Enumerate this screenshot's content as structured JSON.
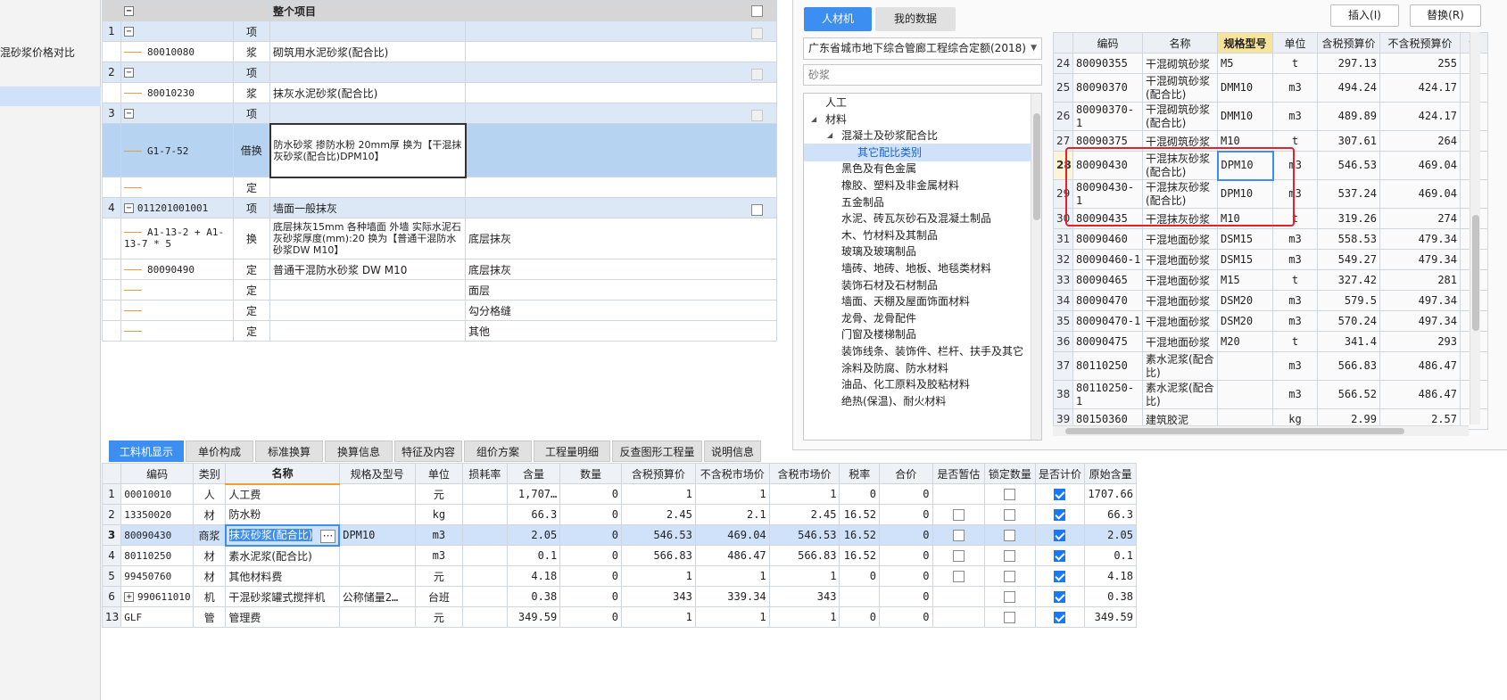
{
  "left_panel": {
    "items": [
      "混砂浆价格对比"
    ]
  },
  "top_grid": {
    "header": {
      "title": "整个项目"
    },
    "rows": [
      {
        "no": "1",
        "expander": "−",
        "code": "",
        "type": "项",
        "name": "",
        "spec": "",
        "row": "blue"
      },
      {
        "no": "",
        "expander": "",
        "code": "80010080",
        "type": "浆",
        "name": "砌筑用水泥砂浆(配合比)",
        "spec": "",
        "row": "white"
      },
      {
        "no": "2",
        "expander": "−",
        "code": "",
        "type": "项",
        "name": "",
        "spec": "",
        "row": "blue"
      },
      {
        "no": "",
        "expander": "",
        "code": "80010230",
        "type": "浆",
        "name": "抹灰水泥砂浆(配合比)",
        "spec": "",
        "row": "white"
      },
      {
        "no": "3",
        "expander": "−",
        "code": "",
        "type": "项",
        "name": "",
        "spec": "",
        "row": "blue"
      },
      {
        "no": "",
        "expander": "",
        "code": "G1-7-52",
        "type": "借换",
        "name": "防水砂浆 掺防水粉 20mm厚  换为【干混抹灰砂浆(配合比)DPM10】",
        "spec": "",
        "row": "sel"
      },
      {
        "no": "",
        "expander": "",
        "code": "",
        "type": "定",
        "name": "",
        "spec": "",
        "row": "white"
      },
      {
        "no": "4",
        "expander": "−",
        "code": "011201001001",
        "type": "项",
        "name": "墙面一般抹灰",
        "spec": "",
        "row": "blue"
      },
      {
        "no": "",
        "expander": "",
        "code": "A1-13-2 + A1-13-7 * 5",
        "type": "换",
        "name": "底层抹灰15mm 各种墙面 外墙  实际水泥石灰砂浆厚度(mm):20  换为【普通干混防水砂浆DW M10】",
        "spec": "底层抹灰",
        "row": "white"
      },
      {
        "no": "",
        "expander": "",
        "code": "80090490",
        "type": "定",
        "name": "普通干混防水砂浆 DW M10",
        "spec": "底层抹灰",
        "row": "white"
      },
      {
        "no": "",
        "expander": "",
        "code": "",
        "type": "定",
        "name": "",
        "spec": "面层",
        "row": "white"
      },
      {
        "no": "",
        "expander": "",
        "code": "",
        "type": "定",
        "name": "",
        "spec": "勾分格缝",
        "row": "white"
      },
      {
        "no": "",
        "expander": "",
        "code": "",
        "type": "定",
        "name": "",
        "spec": "其他",
        "row": "white"
      }
    ]
  },
  "tabs": [
    "工料机显示",
    "单价构成",
    "标准换算",
    "换算信息",
    "特征及内容",
    "组价方案",
    "工程量明细",
    "反查图形工程量",
    "说明信息"
  ],
  "bottom_grid": {
    "columns": [
      "编码",
      "类别",
      "名称",
      "规格及型号",
      "单位",
      "损耗率",
      "含量",
      "数量",
      "含税预算价",
      "不含税市场价",
      "含税市场价",
      "税率",
      "合价",
      "是否暂估",
      "锁定数量",
      "是否计价",
      "原始含量"
    ],
    "rows": [
      {
        "no": "1",
        "code": "00010010",
        "cat": "人",
        "name": "人工费",
        "spec": "",
        "unit": "元",
        "loss": "",
        "qty": "1,707…",
        "amt": "0",
        "p1": "1",
        "p2": "1",
        "p3": "1",
        "tax": "0",
        "total": "0",
        "est": "none",
        "lock": "off",
        "price": "on",
        "orig": "1707.66"
      },
      {
        "no": "2",
        "code": "13350020",
        "cat": "材",
        "name": "防水粉",
        "spec": "",
        "unit": "kg",
        "loss": "",
        "qty": "66.3",
        "amt": "0",
        "p1": "2.45",
        "p2": "2.1",
        "p3": "2.45",
        "tax": "16.52",
        "total": "0",
        "est": "off",
        "lock": "off",
        "price": "on",
        "orig": "66.3"
      },
      {
        "no": "3",
        "code": "80090430",
        "cat": "商浆",
        "name": "抹灰砂浆(配合比)",
        "spec": "DPM10",
        "unit": "m3",
        "loss": "",
        "qty": "2.05",
        "amt": "0",
        "p1": "546.53",
        "p2": "469.04",
        "p3": "546.53",
        "tax": "16.52",
        "total": "0",
        "est": "off",
        "lock": "off",
        "price": "on",
        "orig": "2.05"
      },
      {
        "no": "4",
        "code": "80110250",
        "cat": "材",
        "name": "素水泥浆(配合比)",
        "spec": "",
        "unit": "m3",
        "loss": "",
        "qty": "0.1",
        "amt": "0",
        "p1": "566.83",
        "p2": "486.47",
        "p3": "566.83",
        "tax": "16.52",
        "total": "0",
        "est": "off",
        "lock": "off",
        "price": "on",
        "orig": "0.1"
      },
      {
        "no": "5",
        "code": "99450760",
        "cat": "材",
        "name": "其他材料费",
        "spec": "",
        "unit": "元",
        "loss": "",
        "qty": "4.18",
        "amt": "0",
        "p1": "1",
        "p2": "1",
        "p3": "1",
        "tax": "0",
        "total": "0",
        "est": "off",
        "lock": "off",
        "price": "on",
        "orig": "4.18"
      },
      {
        "no": "6",
        "code": "990611010",
        "cat": "机",
        "name": "干混砂浆罐式搅拌机",
        "spec": "公称储量2…",
        "unit": "台班",
        "loss": "",
        "qty": "0.38",
        "amt": "0",
        "p1": "343",
        "p2": "339.34",
        "p3": "343",
        "tax": "",
        "total": "0",
        "est": "none",
        "lock": "off",
        "price": "on",
        "orig": "0.38"
      },
      {
        "no": "13",
        "code": "GLF",
        "cat": "管",
        "name": "管理费",
        "spec": "",
        "unit": "元",
        "loss": "",
        "qty": "349.59",
        "amt": "0",
        "p1": "1",
        "p2": "1",
        "p3": "1",
        "tax": "0",
        "total": "0",
        "est": "none",
        "lock": "off",
        "price": "on",
        "orig": "349.59"
      }
    ]
  },
  "dialog": {
    "tab_active": "人材机",
    "tab_other": "我的数据",
    "insert": "插入(I)",
    "replace": "替换(R)",
    "quota": "广东省城市地下综合管廊工程综合定额(2018)",
    "search_placeholder": "砂浆",
    "tree": [
      {
        "label": "人工",
        "lvl": 0,
        "arrow": ""
      },
      {
        "label": "材料",
        "lvl": 0,
        "arrow": "◢"
      },
      {
        "label": "混凝土及砂浆配合比",
        "lvl": 1,
        "arrow": "◢"
      },
      {
        "label": "其它配比类别",
        "lvl": 2,
        "arrow": "",
        "sel": true
      },
      {
        "label": "黑色及有色金属",
        "lvl": 1,
        "arrow": ""
      },
      {
        "label": "橡胶、塑料及非金属材料",
        "lvl": 1,
        "arrow": ""
      },
      {
        "label": "五金制品",
        "lvl": 1,
        "arrow": ""
      },
      {
        "label": "水泥、砖瓦灰砂石及混凝土制品",
        "lvl": 1,
        "arrow": ""
      },
      {
        "label": "木、竹材料及其制品",
        "lvl": 1,
        "arrow": ""
      },
      {
        "label": "玻璃及玻璃制品",
        "lvl": 1,
        "arrow": ""
      },
      {
        "label": "墙砖、地砖、地板、地毯类材料",
        "lvl": 1,
        "arrow": ""
      },
      {
        "label": "装饰石材及石材制品",
        "lvl": 1,
        "arrow": ""
      },
      {
        "label": "墙面、天棚及屋面饰面材料",
        "lvl": 1,
        "arrow": ""
      },
      {
        "label": "龙骨、龙骨配件",
        "lvl": 1,
        "arrow": ""
      },
      {
        "label": "门窗及楼梯制品",
        "lvl": 1,
        "arrow": ""
      },
      {
        "label": "装饰线条、装饰件、栏杆、扶手及其它",
        "lvl": 1,
        "arrow": ""
      },
      {
        "label": "涂料及防腐、防水材料",
        "lvl": 1,
        "arrow": ""
      },
      {
        "label": "油品、化工原料及胶粘材料",
        "lvl": 1,
        "arrow": ""
      },
      {
        "label": "绝热(保温)、耐火材料",
        "lvl": 1,
        "arrow": ""
      }
    ],
    "grid_columns": [
      "编码",
      "名称",
      "规格型号",
      "单位",
      "含税预算价",
      "不含税预算价",
      "含"
    ],
    "grid_rows": [
      {
        "no": "24",
        "code": "80090355",
        "name": "干混砌筑砂浆",
        "spec": "M5",
        "unit": "t",
        "p1": "297.13",
        "p2": "255",
        "x": "1",
        "tall": false
      },
      {
        "no": "25",
        "code": "80090370",
        "name": "干混砌筑砂浆(配合比)",
        "spec": "DMM10",
        "unit": "m3",
        "p1": "494.24",
        "p2": "424.17",
        "x": "1",
        "tall": true
      },
      {
        "no": "26",
        "code": "80090370-1",
        "name": "干混砌筑砂浆(配合比)",
        "spec": "DMM10",
        "unit": "m3",
        "p1": "489.89",
        "p2": "424.17",
        "x": "1",
        "tall": true
      },
      {
        "no": "27",
        "code": "80090375",
        "name": "干混砌筑砂浆",
        "spec": "M10",
        "unit": "t",
        "p1": "307.61",
        "p2": "264",
        "x": "1",
        "tall": false
      },
      {
        "no": "28",
        "code": "80090430",
        "name": "干混抹灰砂浆(配合比)",
        "spec": "DPM10",
        "unit": "m3",
        "p1": "546.53",
        "p2": "469.04",
        "x": "1",
        "tall": true,
        "current": true
      },
      {
        "no": "29",
        "code": "80090430-1",
        "name": "干混抹灰砂浆(配合比)",
        "spec": "DPM10",
        "unit": "m3",
        "p1": "537.24",
        "p2": "469.04",
        "x": "1",
        "tall": true
      },
      {
        "no": "30",
        "code": "80090435",
        "name": "干混抹灰砂浆",
        "spec": "M10",
        "unit": "t",
        "p1": "319.26",
        "p2": "274",
        "x": "1",
        "tall": false
      },
      {
        "no": "31",
        "code": "80090460",
        "name": "干混地面砂浆",
        "spec": "DSM15",
        "unit": "m3",
        "p1": "558.53",
        "p2": "479.34",
        "x": "1",
        "tall": false
      },
      {
        "no": "32",
        "code": "80090460-1",
        "name": "干混地面砂浆",
        "spec": "DSM15",
        "unit": "m3",
        "p1": "549.27",
        "p2": "479.34",
        "x": "1",
        "tall": false
      },
      {
        "no": "33",
        "code": "80090465",
        "name": "干混地面砂浆",
        "spec": "M15",
        "unit": "t",
        "p1": "327.42",
        "p2": "281",
        "x": "1",
        "tall": false
      },
      {
        "no": "34",
        "code": "80090470",
        "name": "干混地面砂浆",
        "spec": "DSM20",
        "unit": "m3",
        "p1": "579.5",
        "p2": "497.34",
        "x": "1",
        "tall": false
      },
      {
        "no": "35",
        "code": "80090470-1",
        "name": "干混地面砂浆",
        "spec": "DSM20",
        "unit": "m3",
        "p1": "570.24",
        "p2": "497.34",
        "x": "1",
        "tall": false
      },
      {
        "no": "36",
        "code": "80090475",
        "name": "干混地面砂浆",
        "spec": "M20",
        "unit": "t",
        "p1": "341.4",
        "p2": "293",
        "x": "1",
        "tall": false
      },
      {
        "no": "37",
        "code": "80110250",
        "name": "素水泥浆(配合比)",
        "spec": "",
        "unit": "m3",
        "p1": "566.83",
        "p2": "486.47",
        "x": "1",
        "tall": true
      },
      {
        "no": "38",
        "code": "80110250-1",
        "name": "素水泥浆(配合比)",
        "spec": "",
        "unit": "m3",
        "p1": "566.52",
        "p2": "486.47",
        "x": "1",
        "tall": true
      },
      {
        "no": "39",
        "code": "80150360",
        "name": "建筑胶泥",
        "spec": "",
        "unit": "kg",
        "p1": "2.99",
        "p2": "2.57",
        "x": "1",
        "tall": false
      }
    ]
  },
  "colors": {
    "accent": "#3c8ff0",
    "highlight_box": "#e8202a",
    "selection": "#b7d3f2"
  }
}
